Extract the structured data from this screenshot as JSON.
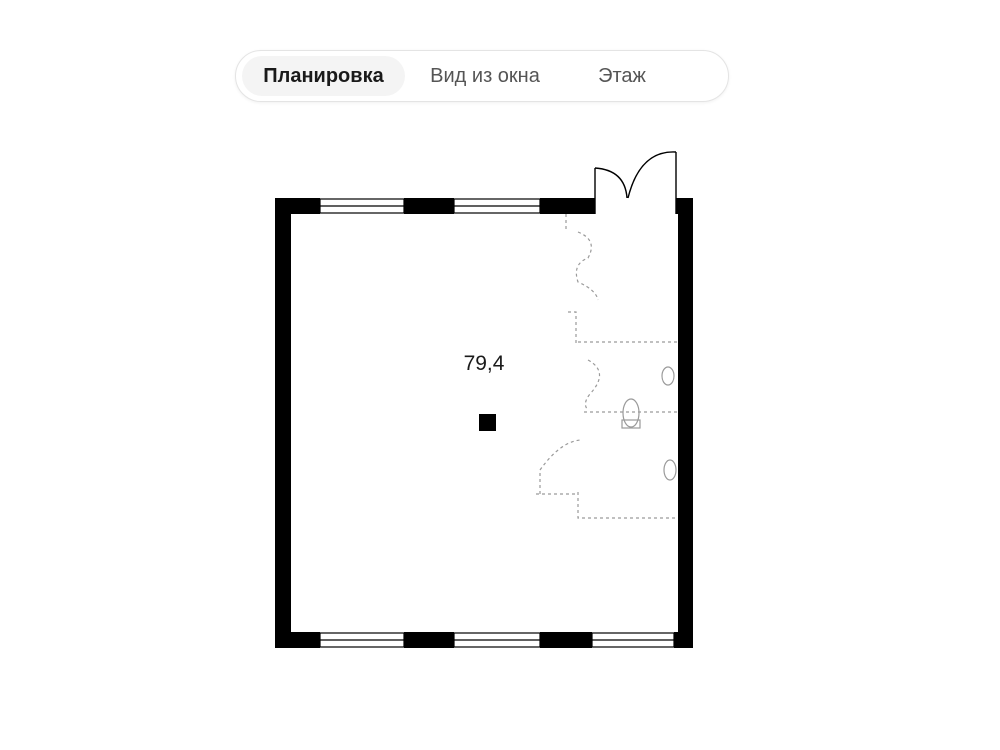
{
  "tabs": {
    "items": [
      {
        "label": "Планировка",
        "active": true
      },
      {
        "label": "Вид из окна",
        "active": false
      },
      {
        "label": "Этаж",
        "active": false
      }
    ]
  },
  "plan": {
    "area_label": "79,4",
    "wall_color": "#000000",
    "window_color": "#000000",
    "furniture_line_color": "#9a9a9a"
  }
}
